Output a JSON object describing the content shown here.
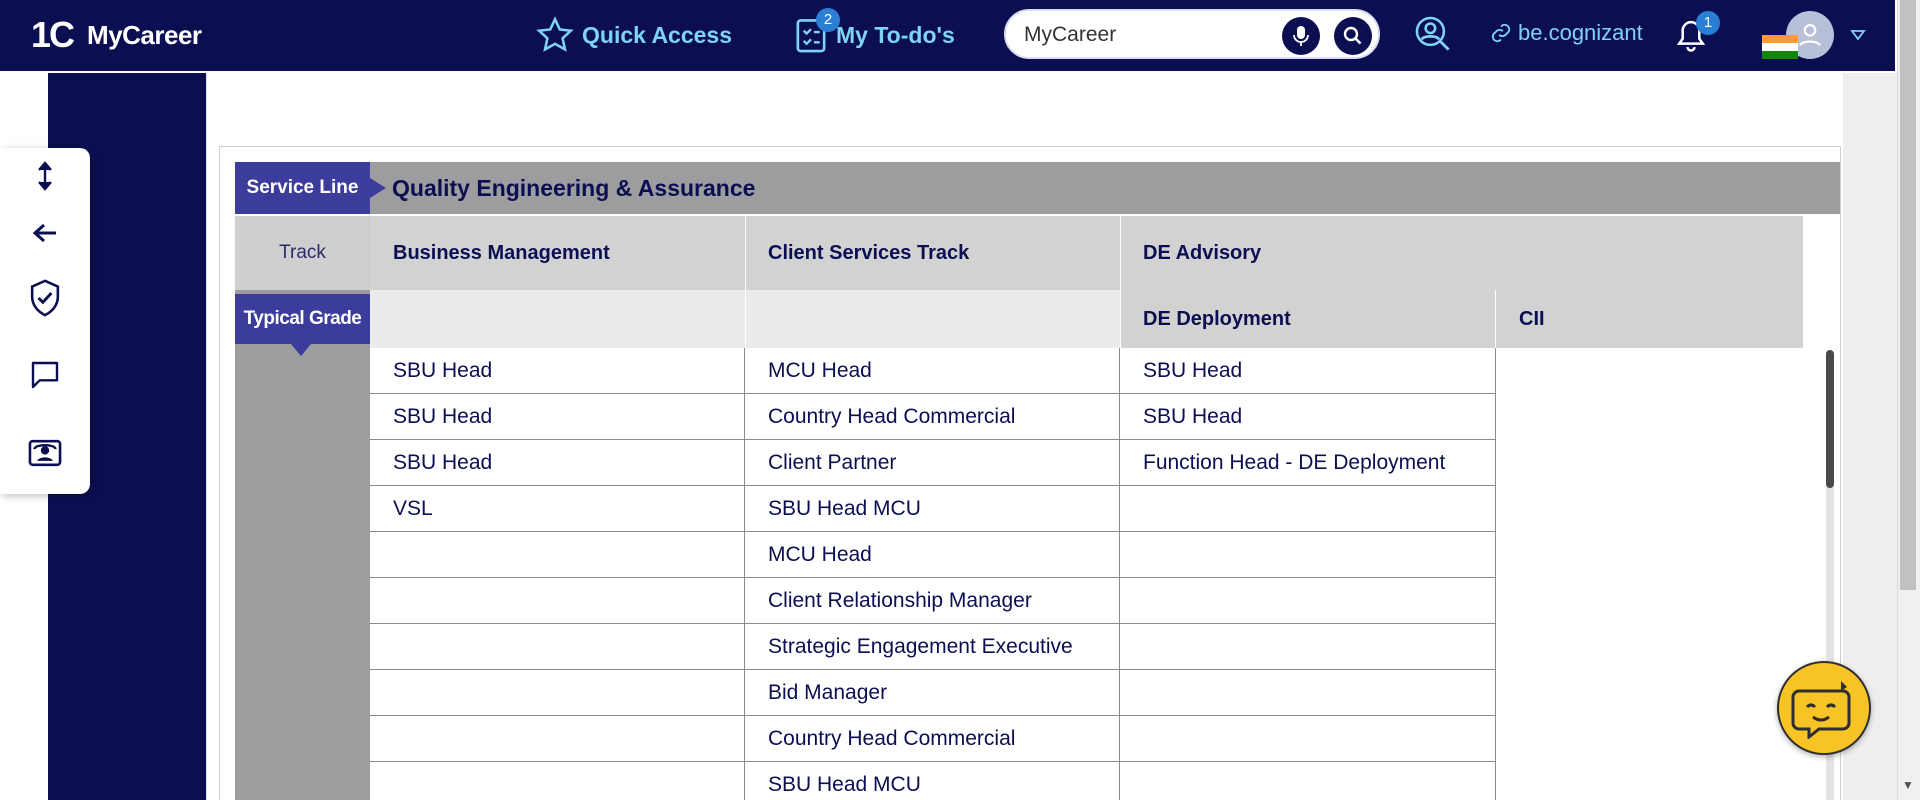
{
  "header": {
    "logo_mark": "1C",
    "app_name": "MyCareer",
    "quick_access_label": "Quick Access",
    "todo_label": "My To-do's",
    "todo_badge": "2",
    "search_value": "MyCareer",
    "link_label": "be.cognizant",
    "notification_badge": "1"
  },
  "table": {
    "service_line_tag": "Service Line",
    "service_line_value": "Quality Engineering & Assurance",
    "track_tag": "Track",
    "typical_grade_tag": "Typical Grade",
    "tracks": [
      "Business Management",
      "Client Services Track",
      "DE Advisory"
    ],
    "sub_tracks": [
      "",
      "",
      "DE Deployment",
      "CII"
    ],
    "rows": [
      [
        "SBU Head",
        "MCU Head",
        "SBU Head"
      ],
      [
        "SBU Head",
        "Country Head Commercial",
        "SBU Head"
      ],
      [
        "SBU Head",
        "Client Partner",
        "Function Head - DE Deployment"
      ],
      [
        "VSL",
        "SBU Head MCU",
        ""
      ],
      [
        "",
        "MCU Head",
        ""
      ],
      [
        "",
        "Client Relationship Manager",
        ""
      ],
      [
        "",
        "Strategic Engagement Executive",
        ""
      ],
      [
        "",
        "Bid Manager",
        ""
      ],
      [
        "",
        "Country Head Commercial",
        ""
      ],
      [
        "",
        "SBU Head MCU",
        ""
      ]
    ]
  },
  "colors": {
    "navy": "#0b0f52",
    "accent_cyan": "#7fd3f5",
    "tag_purple": "#3c3c9c",
    "grey_band": "#9d9d9f",
    "chatbot_yellow": "#f7c325"
  },
  "icons": {
    "sidebar": [
      "expand-vertical-icon",
      "back-arrow-icon",
      "shield-check-icon",
      "chat-icon",
      "support-ticket-icon"
    ]
  }
}
